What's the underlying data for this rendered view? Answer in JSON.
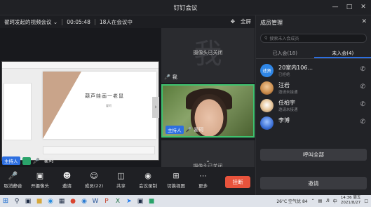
{
  "window": {
    "title": "钉钉会议"
  },
  "meeting": {
    "name": "翟珂发起的视频会议",
    "duration": "00:05:48",
    "participants_text": "18人在会议中",
    "fullscreen_label": "全屏"
  },
  "share": {
    "slide_title": "葫芦娃画一老鼠",
    "slide_sub": "翟珂"
  },
  "stage_footer": {
    "host_badge": "主持人",
    "name": "翟珂"
  },
  "tiles": [
    {
      "big_char": "我",
      "camera_text": "摄像头已关闭",
      "name": "我"
    },
    {
      "host_badge": "主持人",
      "name": "翟珂"
    },
    {
      "camera_text": "摄像头已关闭"
    }
  ],
  "toolbar": {
    "items": [
      {
        "label": "取消静音",
        "icon": "mic-icon"
      },
      {
        "label": "开摄像头",
        "icon": "camera-icon"
      },
      {
        "label": "邀请",
        "icon": "invite-icon"
      },
      {
        "label": "成员(22)",
        "icon": "members-icon"
      },
      {
        "label": "共享",
        "icon": "share-icon"
      },
      {
        "label": "会议录制",
        "icon": "record-icon"
      },
      {
        "label": "切换视图",
        "icon": "grid-icon"
      },
      {
        "label": "更多",
        "icon": "more-icon"
      }
    ],
    "end_label": "挂断"
  },
  "panel": {
    "title": "成员管理",
    "search_placeholder": "搜索未入会成员",
    "tabs": [
      {
        "label": "已入会(18)",
        "active": false
      },
      {
        "label": "未入会(4)",
        "active": true
      }
    ],
    "members": [
      {
        "name": "20室内106...",
        "status": "已拒绝",
        "avatar_text": "述贤",
        "avatar_color": "#2f86e6"
      },
      {
        "name": "汪岩",
        "status": "邀请未接通",
        "avatar_text": "",
        "avatar_color": "#c98a4a"
      },
      {
        "name": "任柏宇",
        "status": "邀请未接通",
        "avatar_text": "",
        "avatar_color": "#e8c9a0"
      },
      {
        "name": "李博",
        "status": "",
        "avatar_text": "",
        "avatar_color": "#3b6fd6"
      }
    ],
    "call_all_label": "呼叫全部",
    "invite_label": "邀请"
  },
  "taskbar": {
    "weather": "26°C 空气优 84",
    "ime": "中",
    "time": "14:36 周五",
    "date": "2021/8/27"
  }
}
